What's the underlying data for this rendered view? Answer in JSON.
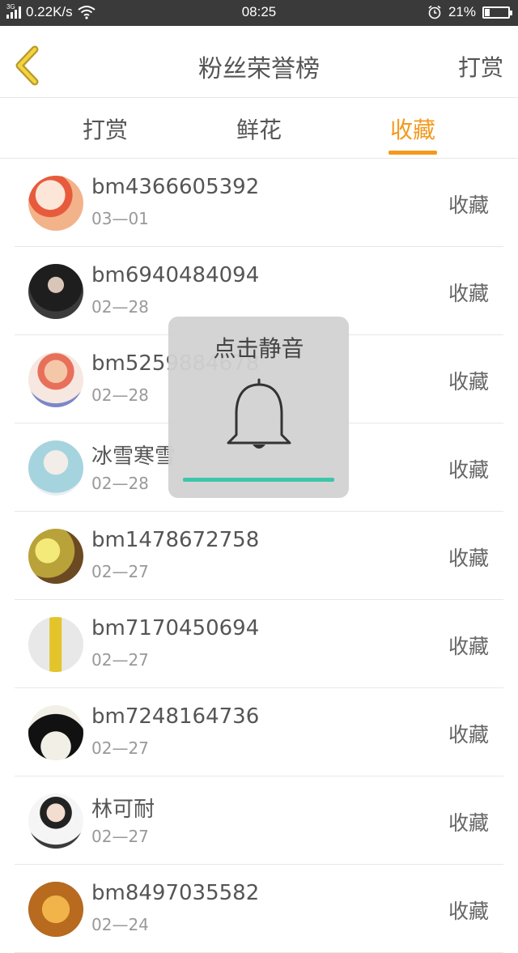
{
  "status_bar": {
    "network": "3G",
    "speed": "0.22K/s",
    "time": "08:25",
    "battery_percent": "21%",
    "battery_level": 0.21
  },
  "header": {
    "title": "粉丝荣誉榜",
    "right_action": "打赏"
  },
  "tabs": [
    {
      "label": "打赏",
      "active": false
    },
    {
      "label": "鲜花",
      "active": false
    },
    {
      "label": "收藏",
      "active": true
    }
  ],
  "accent_color": "#f39a1e",
  "fans": [
    {
      "name": "bm4366605392",
      "date": "03—01",
      "action": "收藏"
    },
    {
      "name": "bm6940484094",
      "date": "02—28",
      "action": "收藏"
    },
    {
      "name": "bm5259884678",
      "date": "02—28",
      "action": "收藏"
    },
    {
      "name": "冰雪寒雪",
      "date": "02—28",
      "action": "收藏"
    },
    {
      "name": "bm1478672758",
      "date": "02—27",
      "action": "收藏"
    },
    {
      "name": "bm7170450694",
      "date": "02—27",
      "action": "收藏"
    },
    {
      "name": "bm7248164736",
      "date": "02—27",
      "action": "收藏"
    },
    {
      "name": "林可耐",
      "date": "02—27",
      "action": "收藏"
    },
    {
      "name": "bm8497035582",
      "date": "02—24",
      "action": "收藏"
    }
  ],
  "mute_toast": {
    "label": "点击静音",
    "icon": "bell-icon",
    "progress_color": "#3ec6a9",
    "progress": 0.89
  }
}
